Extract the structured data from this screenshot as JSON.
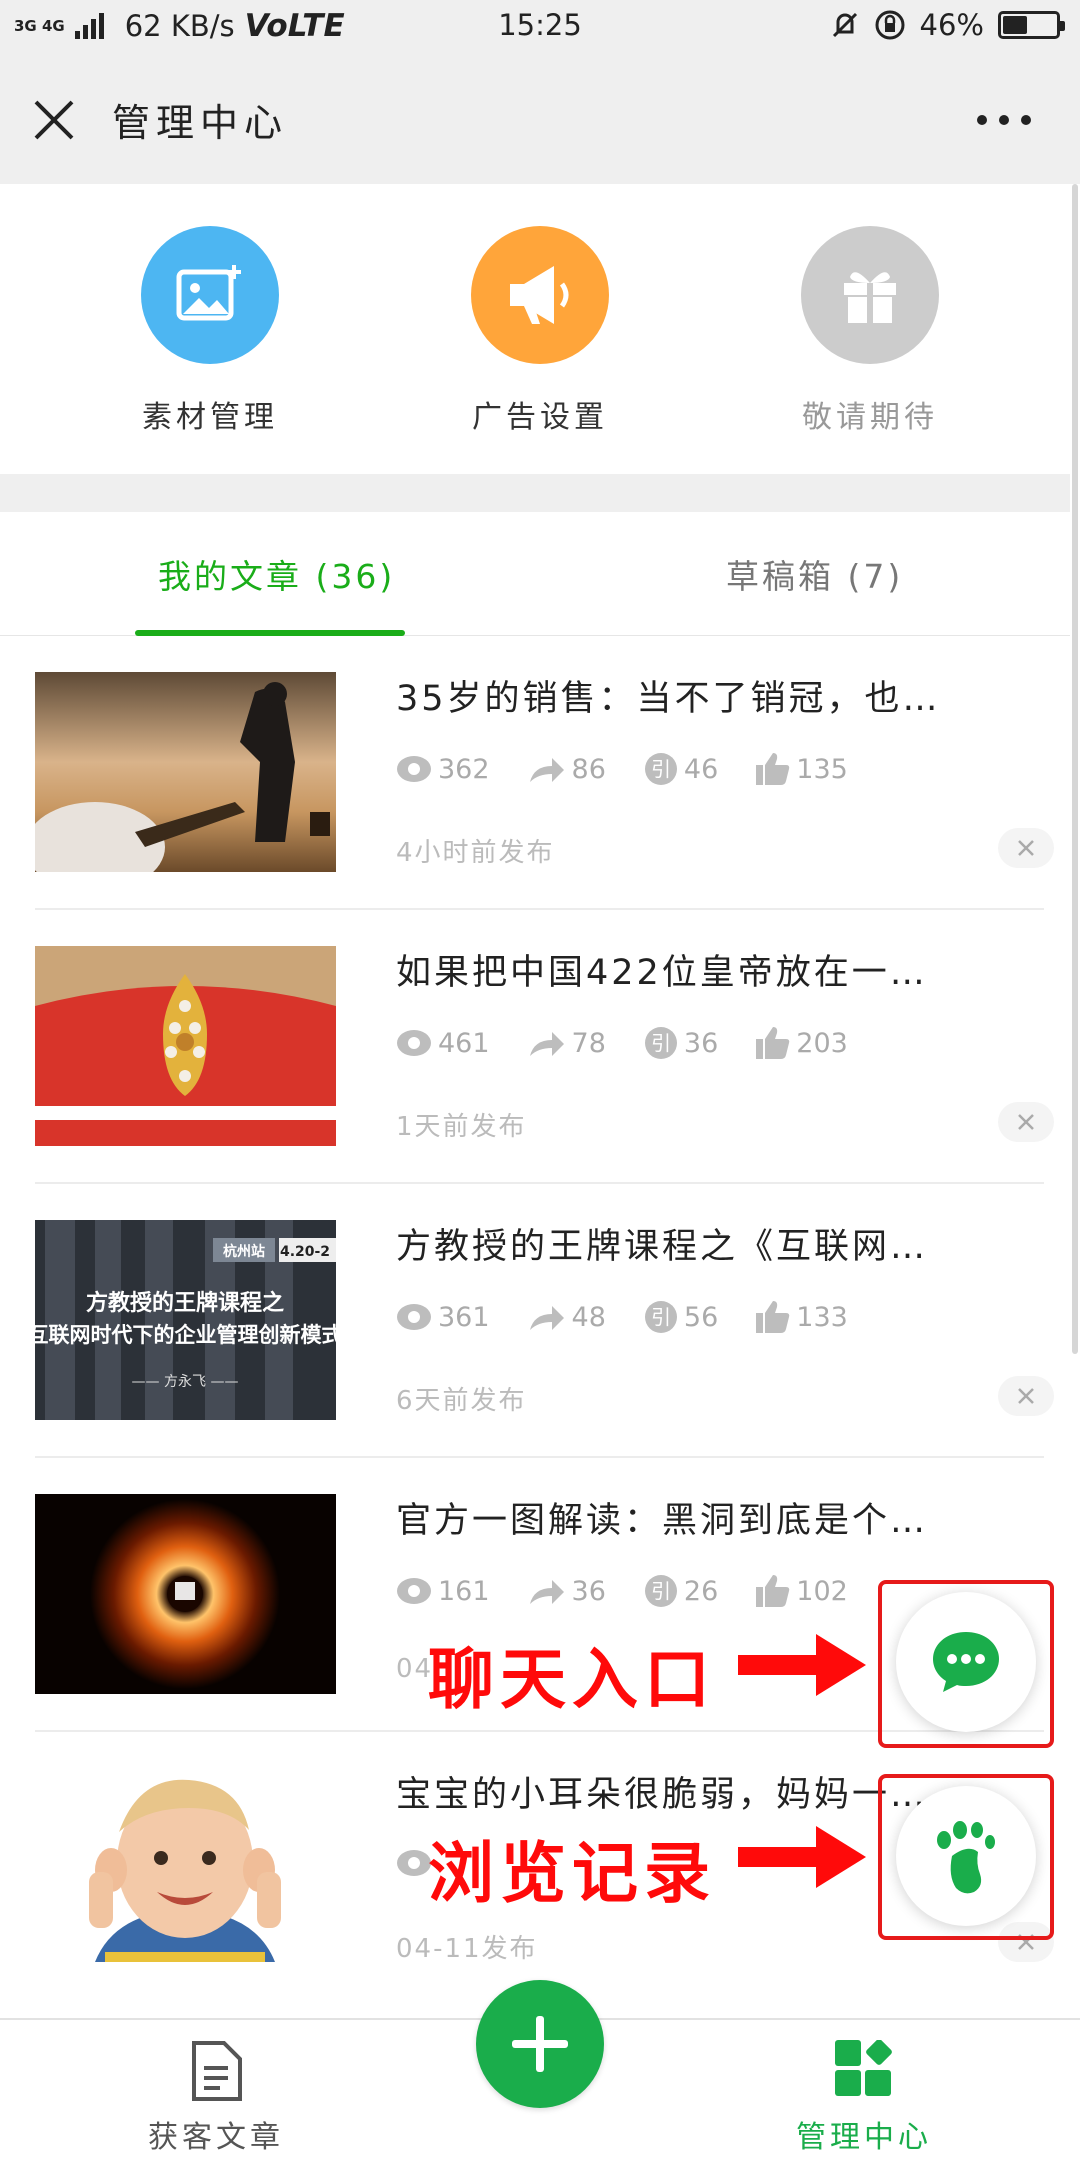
{
  "status_bar": {
    "network": "3G 4G",
    "speed": "62 KB/s",
    "volte": "VoLTE",
    "time": "15:25",
    "battery": "46%",
    "battery_level": 0.46
  },
  "header": {
    "title": "管理中心"
  },
  "features": [
    {
      "label": "素材管理",
      "icon": "image-add-icon",
      "color": "#4db6f2"
    },
    {
      "label": "广告设置",
      "icon": "megaphone-icon",
      "color": "#ffa53a"
    },
    {
      "label": "敬请期待",
      "icon": "gift-icon",
      "color": "#cccccc"
    }
  ],
  "tabs": [
    {
      "label": "我的文章 (36)",
      "active": true
    },
    {
      "label": "草稿箱 (7)",
      "active": false
    }
  ],
  "articles": [
    {
      "title": "35岁的销售：当不了销冠，也…",
      "views": "362",
      "shares": "86",
      "quotes": "46",
      "likes": "135",
      "time": "4小时前发布"
    },
    {
      "title": "如果把中国422位皇帝放在一…",
      "views": "461",
      "shares": "78",
      "quotes": "36",
      "likes": "203",
      "time": "1天前发布"
    },
    {
      "title": "方教授的王牌课程之《互联网…",
      "views": "361",
      "shares": "48",
      "quotes": "56",
      "likes": "133",
      "time": "6天前发布",
      "thumb_tag": "杭州站",
      "thumb_date": "4.20-2",
      "thumb_line1": "方教授的王牌课程之",
      "thumb_line2": "互联网时代下的企业管理创新模式",
      "thumb_line3": "—— 方永飞 ——"
    },
    {
      "title": "官方一图解读：黑洞到底是个…",
      "views": "161",
      "shares": "36",
      "quotes": "26",
      "likes": "102",
      "time": "04"
    },
    {
      "title": "宝宝的小耳朵很脆弱，妈妈一…",
      "views": "",
      "shares": "",
      "quotes": "",
      "likes": "",
      "time": "04-11发布"
    }
  ],
  "stat_icon_quote": "引",
  "overlays": {
    "chat_label": "聊天入口",
    "history_label": "浏览记录"
  },
  "bottom_nav": {
    "left_label": "获客文章",
    "right_label": "管理中心"
  },
  "colors": {
    "accent": "#1aad19",
    "annotation": "#ff0a0a"
  }
}
